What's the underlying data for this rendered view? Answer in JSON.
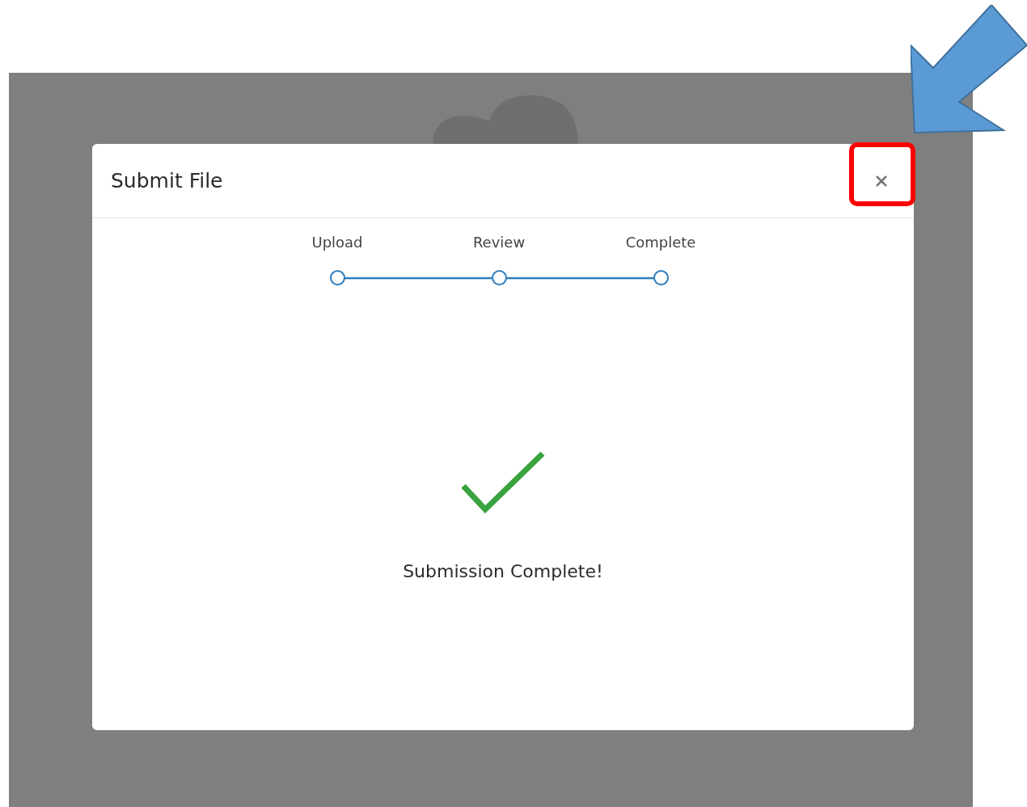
{
  "dialog": {
    "title": "Submit File"
  },
  "steps": [
    {
      "label": "Upload"
    },
    {
      "label": "Review"
    },
    {
      "label": "Complete"
    }
  ],
  "result": {
    "message": "Submission Complete!"
  }
}
